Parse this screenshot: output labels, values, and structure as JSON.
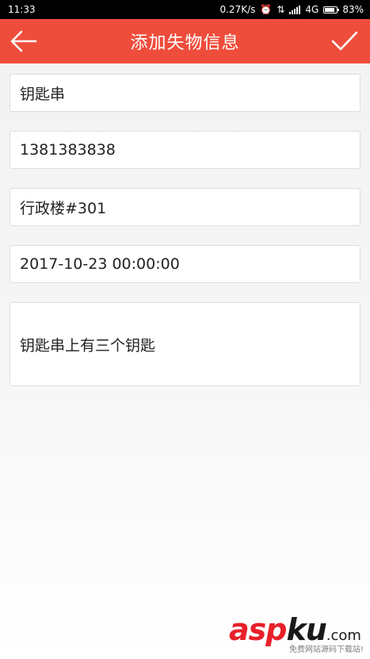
{
  "status_bar": {
    "time": "11:33",
    "network_speed": "0.27K/s",
    "alarm_icon": "alarm-clock-icon",
    "data_icon": "data-transfer-icon",
    "signal_icon": "cell-signal-icon",
    "network_type": "4G",
    "battery_icon": "battery-icon",
    "battery_percent": "83%",
    "battery_level": 0.83
  },
  "app_bar": {
    "title": "添加失物信息",
    "back_icon": "arrow-left-icon",
    "confirm_icon": "checkmark-icon",
    "background_color": "#ef4d3c"
  },
  "form": {
    "item_name": "钥匙串",
    "phone": "1381383838",
    "location": "行政楼#301",
    "datetime": "2017-10-23 00:00:00",
    "description": "钥匙串上有三个钥匙"
  },
  "watermark": {
    "brand_main": "asp",
    "brand_accent": "ku",
    "brand_suffix": ".com",
    "tagline": "免费网站源码下载站!",
    "main_color": "#e8202a",
    "accent_color": "#1a1a1a"
  }
}
